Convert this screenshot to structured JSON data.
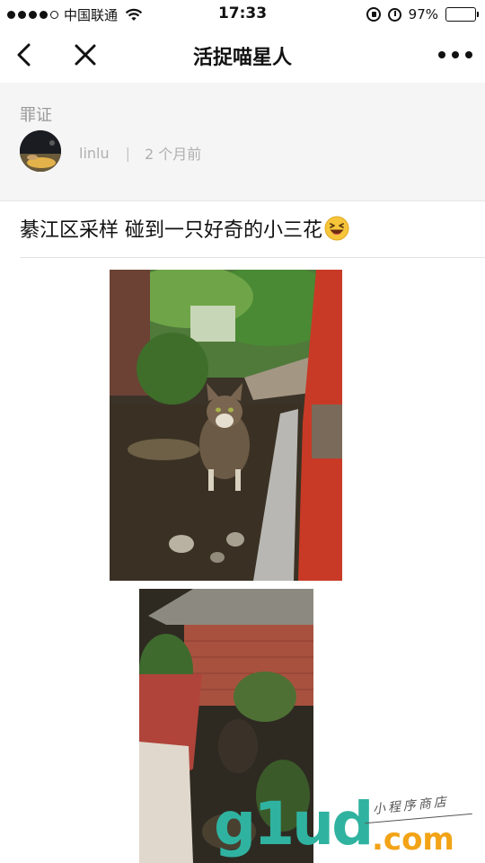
{
  "status_bar": {
    "carrier": "中国联通",
    "time": "17:33",
    "battery": "97%",
    "battery_level": 0.97,
    "signal_bars": 4,
    "signal_max": 5
  },
  "nav": {
    "title": "活捉喵星人",
    "icons": {
      "back": "chevron-left-icon",
      "close": "close-icon",
      "more": "more-icon"
    }
  },
  "author": {
    "category": "罪证",
    "name": "linlu",
    "separator": "|",
    "time_ago": "2 个月前"
  },
  "post": {
    "title": "綦江区采样 碰到一只好奇的小三花",
    "emoji": "laughing-emoji"
  },
  "watermark": {
    "brand": "g1ud",
    "domain": ".com",
    "tagline": "小程序商店"
  },
  "colors": {
    "accent_teal": "#2fb3a0",
    "accent_orange": "#f2a316",
    "panel_bg": "#f5f5f5",
    "muted_text": "#9a9a9a"
  }
}
